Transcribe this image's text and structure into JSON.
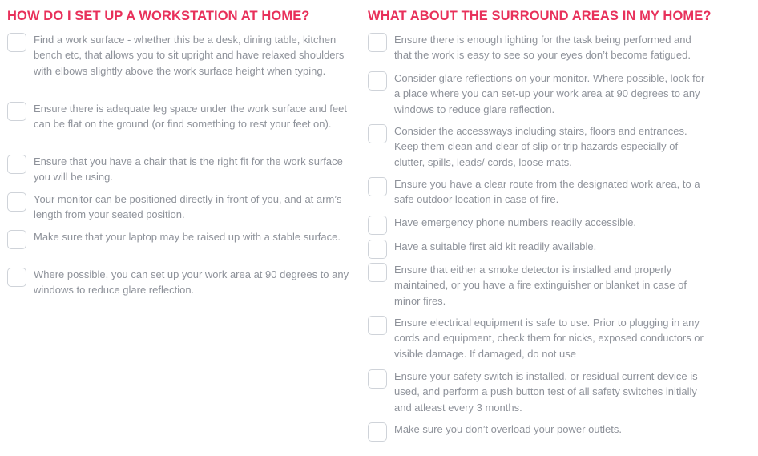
{
  "left": {
    "heading": "HOW DO I SET UP A WORKSTATION AT HOME?",
    "items": [
      {
        "label": "Find a work surface - whether this be a desk, dining table, kitchen bench etc, that allows you to sit upright and have relaxed shoulders with elbows slightly above the work surface height when typing."
      },
      {
        "label": "Ensure there is adequate leg space under the work surface and feet can be flat on the ground (or find something to rest your feet on)."
      },
      {
        "label": "Ensure that you have a chair that is the right fit for the work surface you will be using."
      },
      {
        "label": "Your monitor can be positioned directly in front of you, and at arm’s length from your seated position."
      },
      {
        "label": "Make sure that your laptop may be raised up with a stable surface."
      },
      {
        "label": "Where possible, you can set up your work area at 90 degrees to any windows to reduce glare reflection."
      }
    ]
  },
  "right": {
    "heading": "WHAT ABOUT THE SURROUND AREAS IN MY HOME?",
    "items": [
      {
        "label": "Ensure there is enough lighting for the task being performed and that the work is easy to see so your eyes don’t become fatigued."
      },
      {
        "label": "Consider glare reflections on your monitor. Where possible, look for a place where you can set-up your work area at 90 degrees to any windows to reduce glare reflection."
      },
      {
        "label": "Consider the accessways including stairs, floors and entrances. Keep them clean and clear of slip or trip hazards especially of clutter, spills, leads/ cords, loose mats."
      },
      {
        "label": "Ensure you have a clear route from the designated work area, to a safe outdoor location in case of fire."
      },
      {
        "label": "Have emergency phone numbers readily accessible."
      },
      {
        "label": "Have a suitable first aid kit readily available."
      },
      {
        "label": "Ensure that either a smoke detector is installed and properly maintained, or you have a fire extinguisher or blanket in case of minor fires."
      },
      {
        "label": "Ensure electrical equipment is safe to use. Prior to plugging in any cords and equipment, check them for nicks, exposed conductors or visible damage. If damaged, do not use"
      },
      {
        "label": "Ensure your safety switch is installed, or residual current device is used, and perform a push button test of all safety switches initially and atleast every 3 months."
      },
      {
        "label": "Make sure you don’t overload your power outlets."
      }
    ]
  },
  "colors": {
    "heading": "#e8315b",
    "text": "#8e929a",
    "checkbox_border": "#cfd3d9"
  }
}
